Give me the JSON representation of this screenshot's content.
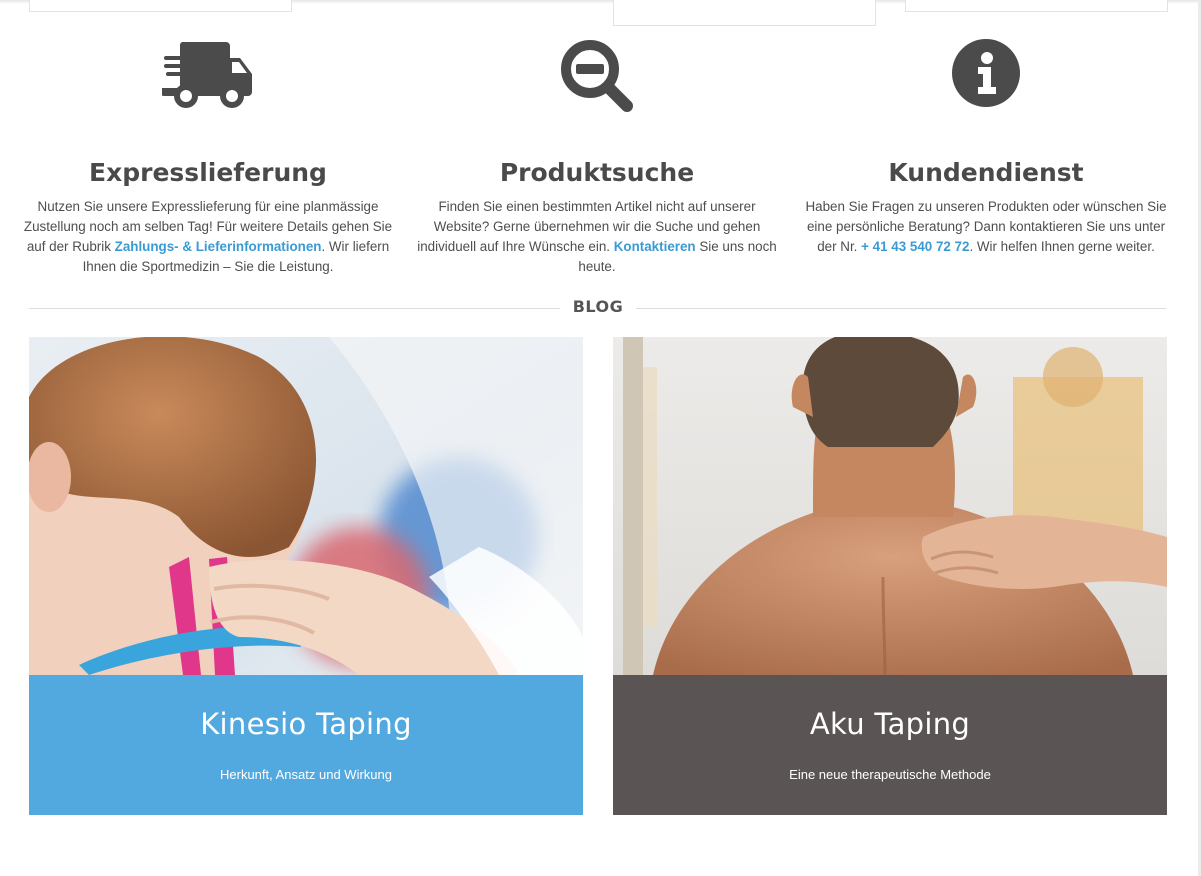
{
  "features": [
    {
      "icon": "delivery-truck-icon",
      "title": "Expresslieferung",
      "text_1": "Nutzen Sie unsere Expresslieferung für eine planmässige Zustellung noch am selben Tag! Für weitere Details gehen Sie auf der Rubrik ",
      "link": "Zahlungs- & Lieferinformationen",
      "text_2": ". Wir liefern Ihnen die Sportmedizin – Sie die Leistung."
    },
    {
      "icon": "search-minus-icon",
      "title": "Produktsuche",
      "text_1": "Finden Sie einen bestimmten Artikel nicht auf unserer Website? Gerne übernehmen wir die Suche und gehen individuell auf Ihre Wünsche ein. ",
      "link": "Kontaktieren",
      "text_2": " Sie uns noch heute."
    },
    {
      "icon": "info-circle-icon",
      "title": "Kundendienst",
      "text_1": "Haben Sie Fragen zu unseren Produkten oder wünschen Sie eine persönliche Beratung? Dann kontaktieren Sie uns unter der Nr. ",
      "link": "+ 41 43 540 72 72",
      "text_2": ". Wir helfen Ihnen gerne weiter."
    }
  ],
  "blog": {
    "heading": "BLOG",
    "posts": [
      {
        "title": "Kinesio Taping",
        "subtitle": "Herkunft, Ansatz und Wirkung",
        "band_color": "#52a9df"
      },
      {
        "title": "Aku Taping",
        "subtitle": "Eine neue therapeutische Methode",
        "band_color": "#5a5554"
      }
    ]
  },
  "colors": {
    "link": "#3a9bd4",
    "icon": "#4b4b4b"
  }
}
